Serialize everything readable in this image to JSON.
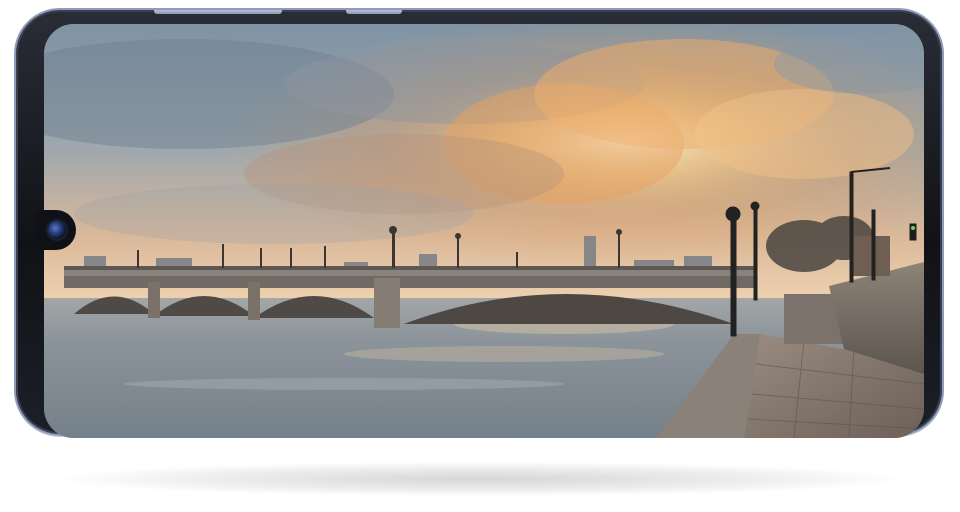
{
  "scene": {
    "subject": "phone-landscape-photo",
    "colors": {
      "sky_top": "#7f93a4",
      "sky_glow": "#f2b36a",
      "water": "#8d98a2",
      "bridge_stone": "#6b6660",
      "phone_frame": "#8f9bb8"
    }
  },
  "icons": {
    "front_camera": "camera-icon"
  }
}
